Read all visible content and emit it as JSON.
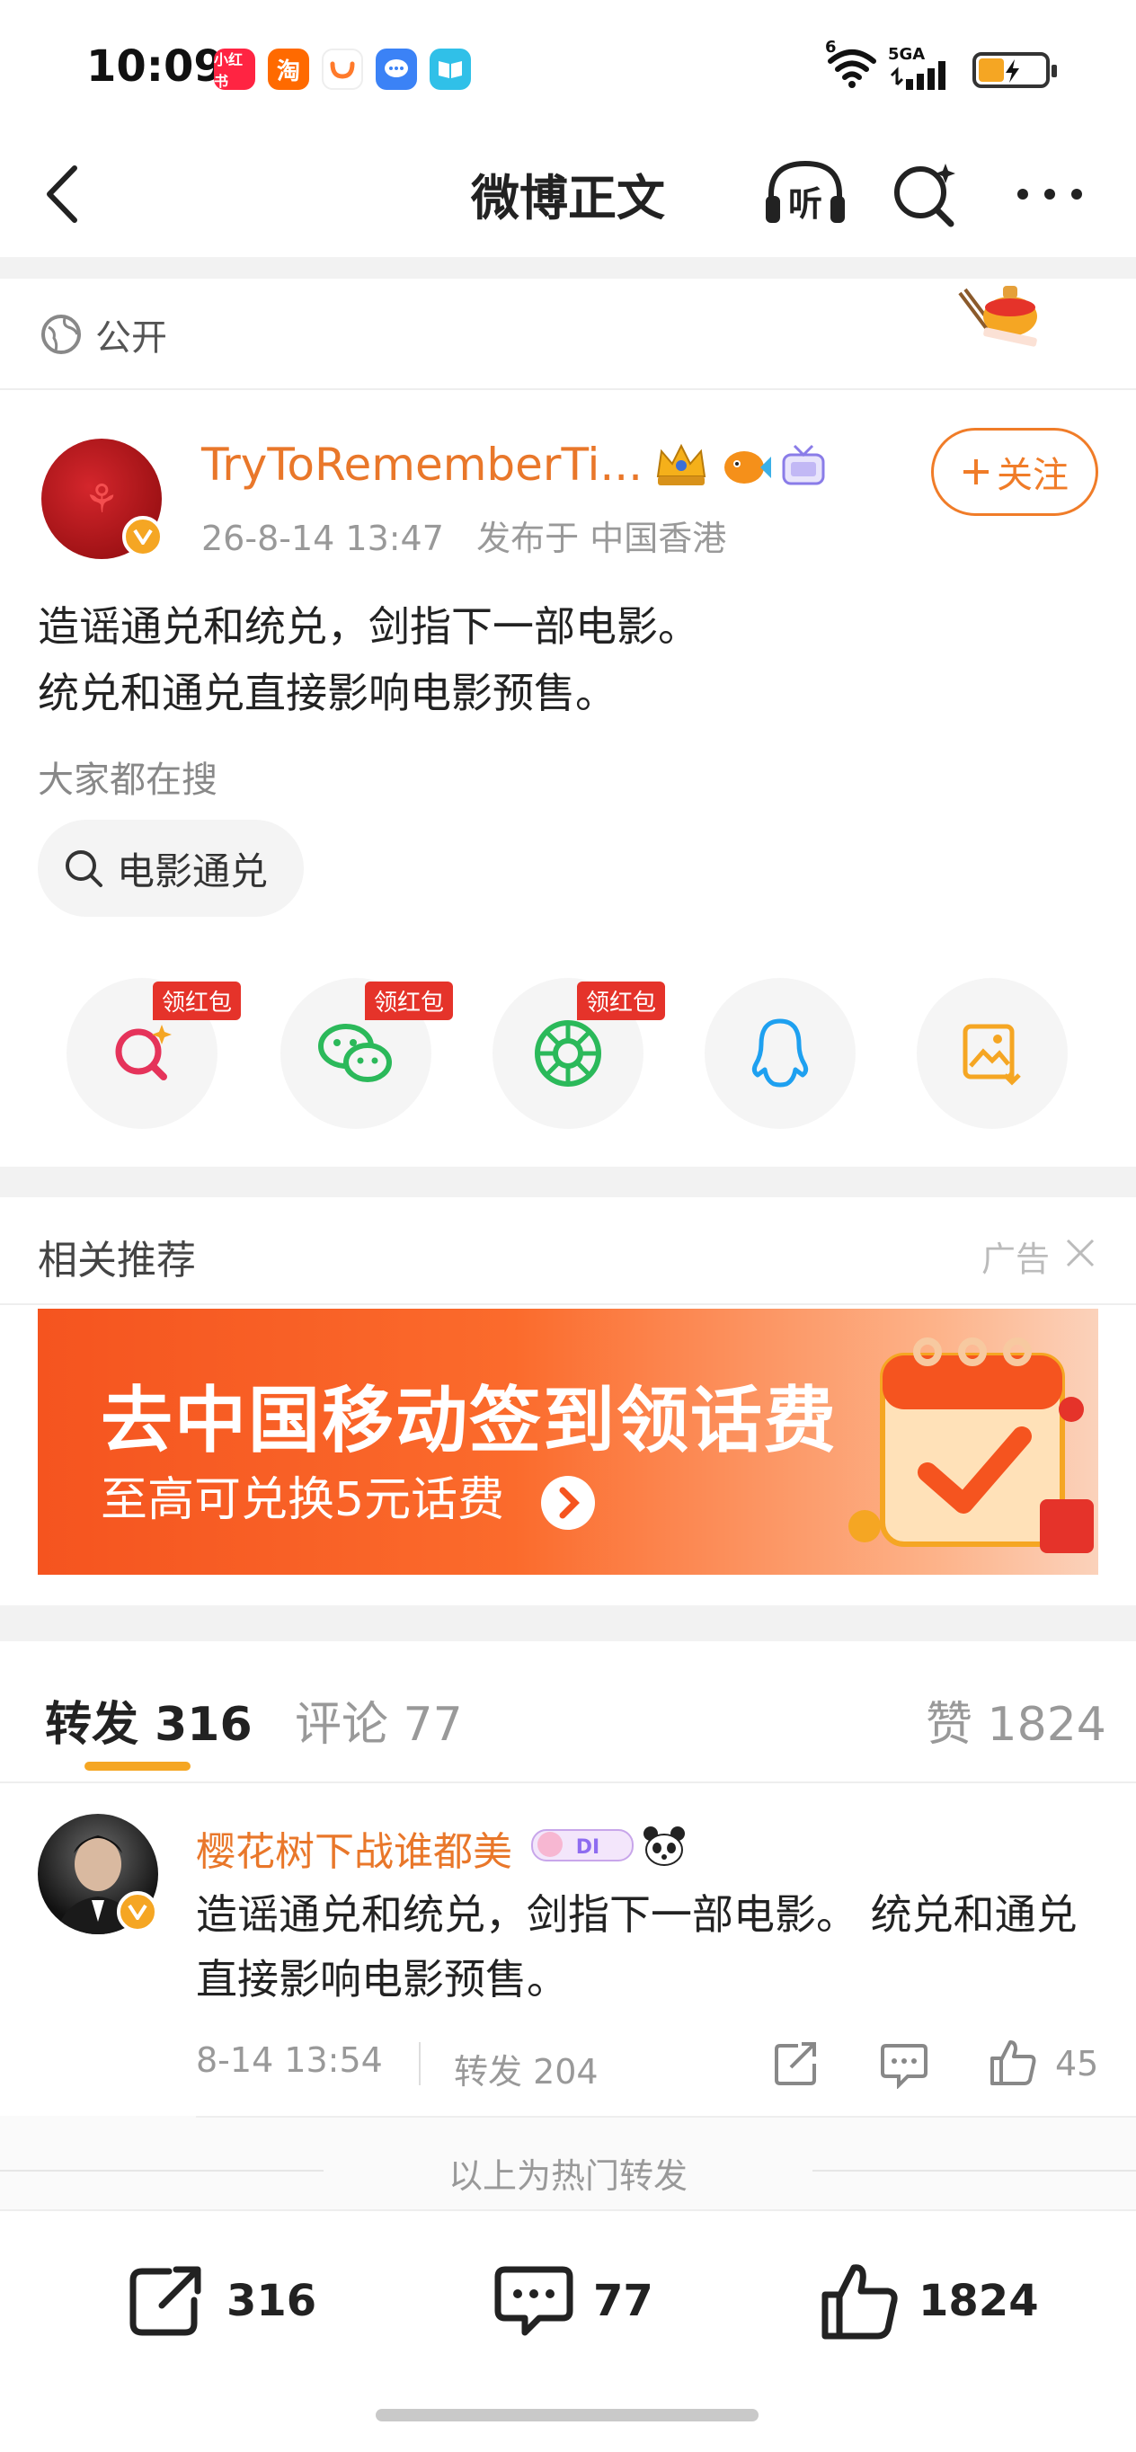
{
  "status_bar": {
    "time": "10:09",
    "app_icons": [
      {
        "name": "xiaohongshu-icon",
        "label": "小红书",
        "color": "#ff2442"
      },
      {
        "name": "taobao-icon",
        "label": "淘",
        "color": "#ff6a00"
      },
      {
        "name": "didi-icon",
        "label": "",
        "color": "#ff7a2b"
      },
      {
        "name": "message-app-icon",
        "label": "",
        "color": "#3b82f6"
      },
      {
        "name": "reader-app-icon",
        "label": "",
        "color": "#30c0e8"
      }
    ],
    "network": "5GA",
    "signal_prefix": "6"
  },
  "nav": {
    "title": "微博正文",
    "listen_label": "听"
  },
  "visibility": {
    "label": "公开"
  },
  "post": {
    "author_name": "TryToRememberTi...",
    "timestamp": "26-8-14 13:47",
    "location": "发布于 中国香港",
    "follow_label": "关注",
    "text_lines": [
      "造谣通兑和统兑，剑指下一部电影。",
      "统兑和通兑直接影响电影预售。"
    ],
    "hot_search_label": "大家都在搜",
    "hot_search_query": "电影通兑"
  },
  "share_targets": [
    {
      "name": "weibo-search-share",
      "badge": "领红包"
    },
    {
      "name": "wechat-share",
      "badge": "领红包"
    },
    {
      "name": "moments-share",
      "badge": "领红包"
    },
    {
      "name": "qq-share",
      "badge": ""
    },
    {
      "name": "save-image-share",
      "badge": ""
    }
  ],
  "recommend": {
    "title": "相关推荐",
    "ad_label": "广告",
    "banner_title": "去中国移动签到领话费",
    "banner_subtitle": "至高可兑换5元话费"
  },
  "tabs": {
    "forward": "转发 316",
    "comment": "评论 77",
    "like": "赞 1824"
  },
  "repost": {
    "user_name": "樱花树下战谁都美",
    "text": "造谣通兑和统兑，剑指下一部电影。 统兑和通兑直接影响电影预售。",
    "time": "8-14 13:54",
    "forward_count": "转发 204",
    "like_count": "45"
  },
  "hot_end_label": "以上为热门转发",
  "bottom_bar": {
    "forward": "316",
    "comment": "77",
    "like": "1824"
  },
  "colors": {
    "accent_orange": "#f07c28",
    "name_orange": "#e9772a",
    "badge_red": "#e5332a",
    "tab_underline": "#f5a623"
  }
}
